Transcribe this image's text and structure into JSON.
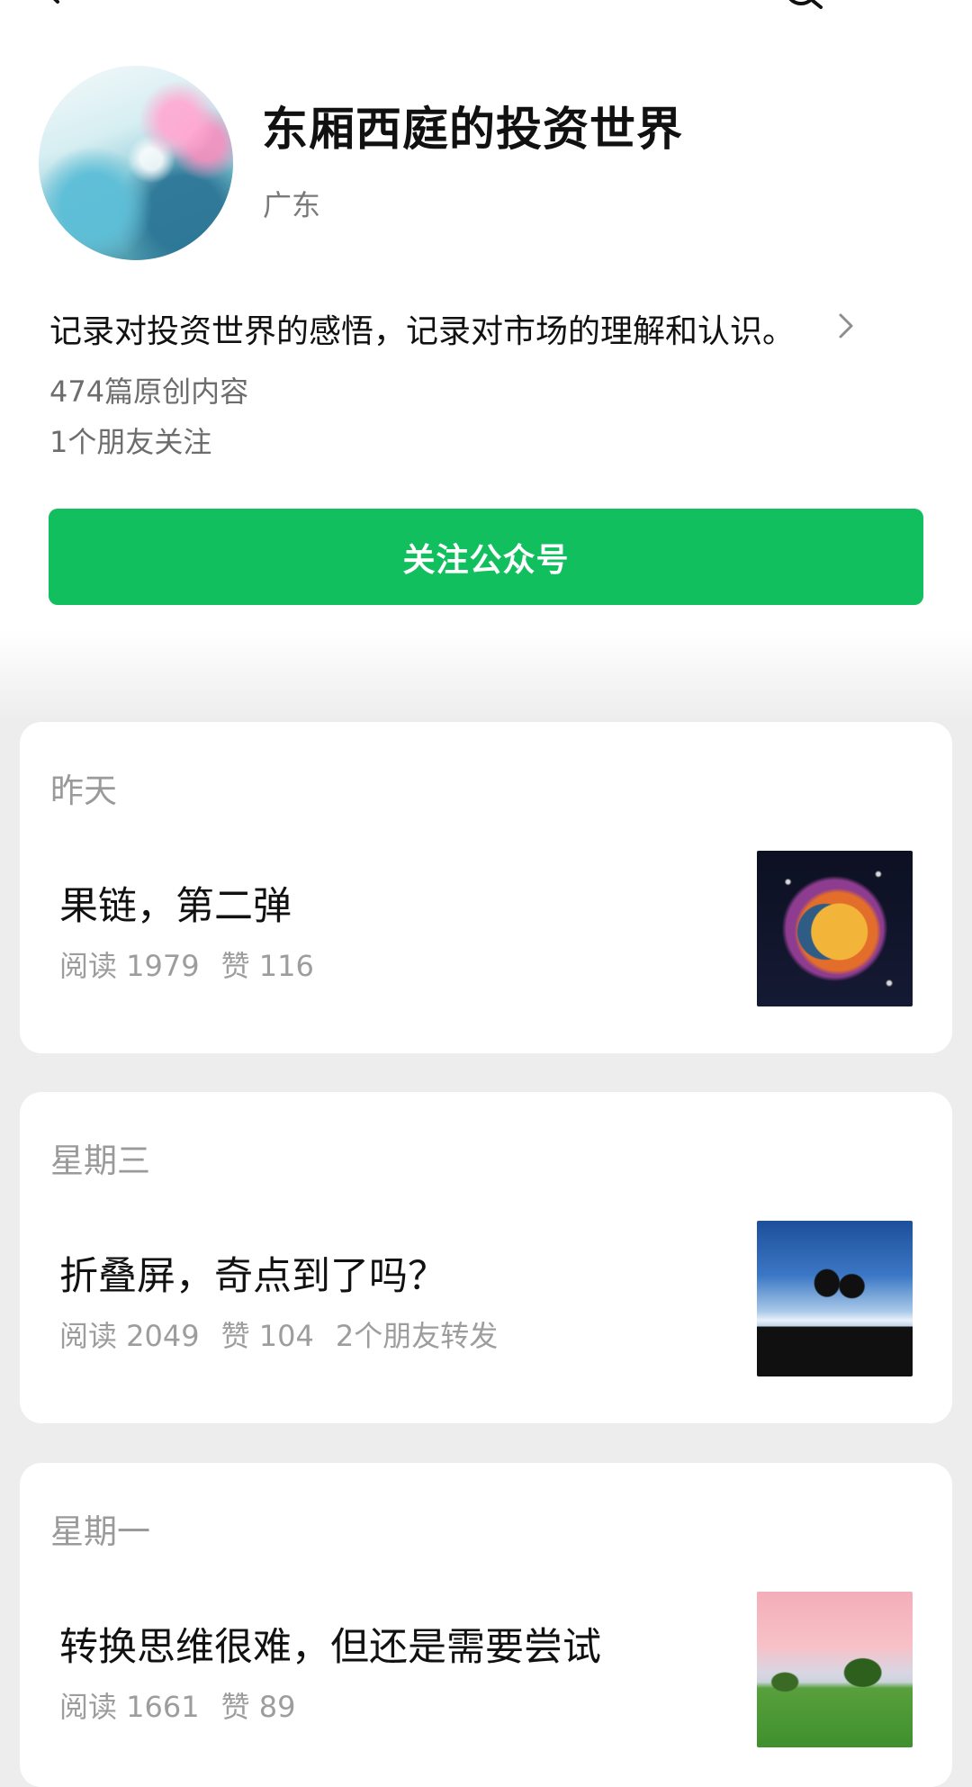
{
  "profile": {
    "name": "东厢西庭的投资世界",
    "region": "广东",
    "bio": "记录对投资世界的感悟，记录对市场的理解和认识。",
    "original_count": "474篇原创内容",
    "friends_following": "1个朋友关注",
    "follow_label": "关注公众号"
  },
  "colors": {
    "accent": "#12bf5f",
    "background": "#ededed"
  },
  "icons": {
    "back": "back-arrow-icon",
    "search": "search-icon",
    "bio_more": "chevron-right-icon"
  },
  "articles": [
    {
      "date": "昨天",
      "title": "果链，第二弹",
      "read": "阅读 1979",
      "likes": "赞 116",
      "shares": "",
      "thumb": "sun-moon-art"
    },
    {
      "date": "星期三",
      "title": "折叠屏，奇点到了吗？",
      "read": "阅读 2049",
      "likes": "赞 104",
      "shares": "2个朋友转发",
      "thumb": "couple-silhouette"
    },
    {
      "date": "星期一",
      "title": "转换思维很难，但还是需要尝试",
      "read": "阅读 1661",
      "likes": "赞 89",
      "shares": "",
      "thumb": "tree-landscape"
    }
  ]
}
